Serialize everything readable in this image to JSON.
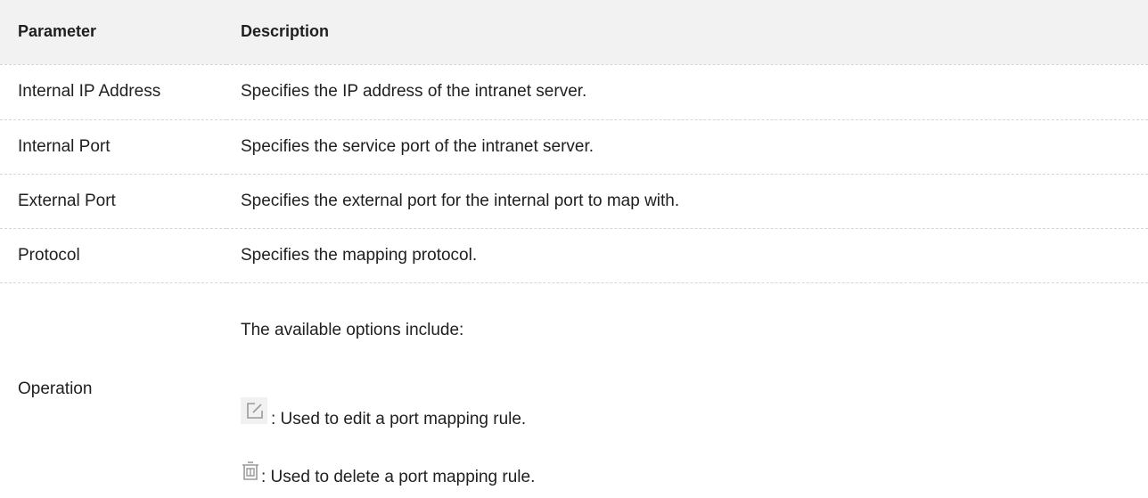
{
  "table": {
    "headers": {
      "parameter": "Parameter",
      "description": "Description"
    },
    "rows": [
      {
        "parameter": "Internal IP Address",
        "description": "Specifies the IP address of the intranet server."
      },
      {
        "parameter": "Internal Port",
        "description": "Specifies the service port of the intranet server."
      },
      {
        "parameter": "External Port",
        "description": "Specifies the external port for the internal port to map with."
      },
      {
        "parameter": "Protocol",
        "description": "Specifies the mapping protocol."
      }
    ],
    "operation": {
      "parameter": "Operation",
      "intro": "The available options include:",
      "edit_text": ": Used to edit a port mapping rule.",
      "delete_text": ": Used to delete a port mapping rule.",
      "edit_icon": "edit-icon",
      "delete_icon": "trash-icon"
    }
  },
  "colors": {
    "header_background": "#f2f2f2",
    "row_divider": "#d6d6d6",
    "icon_gray": "#9a9a9a"
  }
}
